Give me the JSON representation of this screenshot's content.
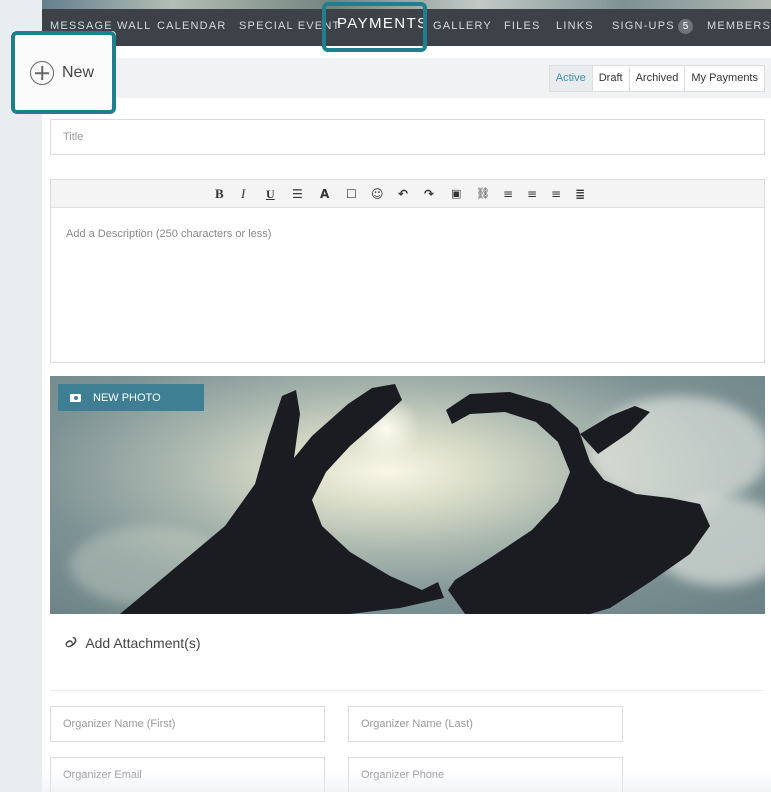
{
  "nav": {
    "items": [
      "MESSAGE WALL",
      "CALENDAR",
      "SPECIAL EVENT",
      "PAYMENTS",
      "GALLERY",
      "FILES",
      "LINKS",
      "SIGN-UPS",
      "MEMBERS"
    ],
    "active": "PAYMENTS",
    "signups_count": "5"
  },
  "toolbar": {
    "new_label": "New",
    "filters": [
      "Active",
      "Draft",
      "Archived",
      "My Payments"
    ],
    "active_filter": "Active"
  },
  "form": {
    "title_placeholder": "Title",
    "description_placeholder": "Add a Description (250 characters or less)",
    "new_photo_label": "NEW PHOTO",
    "attachment_label": "Add Attachment(s)",
    "organizer_first_placeholder": "Organizer Name (First)",
    "organizer_last_placeholder": "Organizer Name (Last)",
    "organizer_email_placeholder": "Organizer Email",
    "organizer_phone_placeholder": "Organizer Phone"
  },
  "editor_toolbar": {
    "bold": "B",
    "italic": "I",
    "underline": "U",
    "list": "☰",
    "font_color": "A",
    "box": "☐",
    "emoji": "☺",
    "undo": "↶",
    "redo": "↷",
    "image": "▣",
    "link": "⛓",
    "align_left": "≡",
    "align_center": "≡",
    "align_right": "≡",
    "justify": "≣"
  },
  "colors": {
    "highlight": "#1f7f8c",
    "nav_bg": "#3c4247",
    "active_filter": "#3f8fa8",
    "photo_button": "#3f7f93"
  }
}
